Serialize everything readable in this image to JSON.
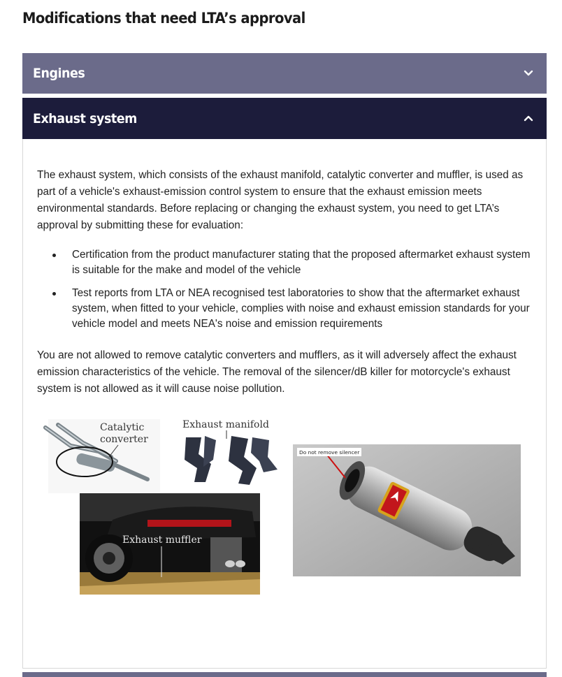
{
  "page": {
    "title": "Modifications that need LTA’s approval"
  },
  "accordion": {
    "engines": {
      "label": "Engines",
      "state": "collapsed",
      "icon": "chevron-down-icon"
    },
    "exhaust": {
      "label": "Exhaust system",
      "state": "expanded",
      "icon": "chevron-up-icon"
    }
  },
  "content": {
    "intro": "The exhaust system, which consists of the exhaust manifold, catalytic converter and muffler, is used as part of a vehicle's exhaust-emission control system to ensure that the exhaust emission meets environmental standards. Before replacing or changing the exhaust system, you need to get LTA’s approval by submitting these for evaluation:",
    "bullets": [
      "Certification from the product manufacturer stating that the proposed aftermarket exhaust system is suitable for the make and model of the vehicle",
      "Test reports from LTA or NEA recognised test laboratories to show that the aftermarket exhaust system, when fitted to your vehicle, complies with noise and exhaust emission standards for your vehicle model and meets NEA's noise and emission requirements"
    ],
    "warning": "You are not allowed to remove catalytic converters and mufflers, as it will adversely affect the exhaust emission characteristics of the vehicle. The removal of the silencer/dB killer for motorcycle's exhaust system is not allowed as it will cause noise pollution."
  },
  "images": {
    "left": {
      "catalytic_label_1": "Catalytic",
      "catalytic_label_2": "converter",
      "manifold_label": "Exhaust manifold",
      "muffler_label": "Exhaust muffler"
    },
    "right": {
      "callout": "Do not remove silencer",
      "brand": "AKRAPOVIC"
    }
  },
  "colors": {
    "header_collapsed": "#6b6b8a",
    "header_expanded": "#1c1c3b",
    "callout_line": "#cc1111"
  }
}
